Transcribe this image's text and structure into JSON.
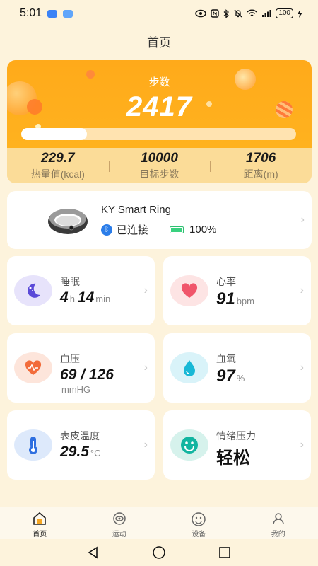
{
  "status_bar": {
    "time": "5:01",
    "battery": "100"
  },
  "header": {
    "title": "首页"
  },
  "steps": {
    "label": "步数",
    "value": "2417",
    "progress_fraction": 0.24,
    "stats": [
      {
        "value": "229.7",
        "label": "热量值(kcal)"
      },
      {
        "value": "10000",
        "label": "目标步数"
      },
      {
        "value": "1706",
        "label": "距离(m)"
      }
    ],
    "colors": {
      "accent": "#ffaa1a"
    }
  },
  "device": {
    "name": "KY Smart Ring",
    "connection": "已连接",
    "battery": "100%"
  },
  "metrics": {
    "sleep": {
      "label": "睡眠",
      "hours": "4",
      "hours_unit": "h",
      "minutes": "14",
      "minutes_unit": "min",
      "icon": "moon-icon"
    },
    "heart_rate": {
      "label": "心率",
      "value": "91",
      "unit": "bpm",
      "icon": "heart-icon"
    },
    "blood_pressure": {
      "label": "血压",
      "value": "69 / 126",
      "unit": "mmHG",
      "icon": "heart-pulse-icon"
    },
    "blood_oxygen": {
      "label": "血氧",
      "value": "97",
      "unit": "%",
      "icon": "droplet-icon"
    },
    "skin_temp": {
      "label": "表皮温度",
      "value": "29.5",
      "unit": "°C",
      "icon": "thermometer-icon"
    },
    "stress": {
      "label": "情绪压力",
      "value": "轻松",
      "icon": "smile-icon"
    }
  },
  "nav": {
    "items": [
      {
        "label": "首页",
        "icon": "home-icon"
      },
      {
        "label": "运动",
        "icon": "eye-icon"
      },
      {
        "label": "设备",
        "icon": "face-icon"
      },
      {
        "label": "我的",
        "icon": "user-icon"
      }
    ]
  }
}
